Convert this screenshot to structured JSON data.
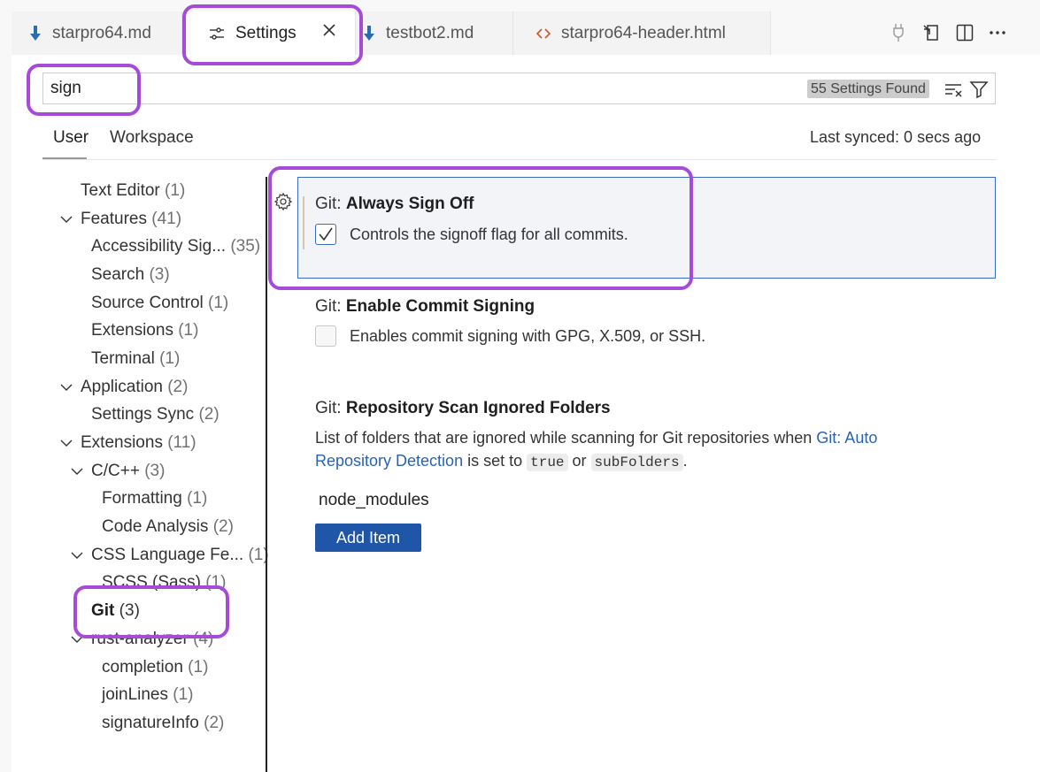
{
  "tabs": [
    {
      "label": "starpro64.md",
      "icon": "markdown-icon"
    },
    {
      "label": "Settings",
      "icon": "settings-sliders-icon",
      "active": true
    },
    {
      "label": "testbot2.md",
      "icon": "markdown-icon"
    },
    {
      "label": "starpro64-header.html",
      "icon": "html-code-icon"
    }
  ],
  "search": {
    "value": "sign",
    "found": "55 Settings Found"
  },
  "scope": {
    "user": "User",
    "workspace": "Workspace",
    "last_synced": "Last synced: 0 secs ago"
  },
  "toc": [
    {
      "label": "Text Editor",
      "count": "(1)"
    },
    {
      "label": "Features",
      "count": "(41)"
    },
    {
      "label": "Accessibility Sig...",
      "count": "(35)"
    },
    {
      "label": "Search",
      "count": "(3)"
    },
    {
      "label": "Source Control",
      "count": "(1)"
    },
    {
      "label": "Extensions",
      "count": "(1)"
    },
    {
      "label": "Terminal",
      "count": "(1)"
    },
    {
      "label": "Application",
      "count": "(2)"
    },
    {
      "label": "Settings Sync",
      "count": "(2)"
    },
    {
      "label": "Extensions",
      "count": "(11)"
    },
    {
      "label": "C/C++",
      "count": "(3)"
    },
    {
      "label": "Formatting",
      "count": "(1)"
    },
    {
      "label": "Code Analysis",
      "count": "(2)"
    },
    {
      "label": "CSS Language Fe...",
      "count": "(1)"
    },
    {
      "label": "SCSS (Sass)",
      "count": "(1)"
    },
    {
      "label": "Git",
      "count": "(3)"
    },
    {
      "label": "rust-analyzer",
      "count": "(4)"
    },
    {
      "label": "completion",
      "count": "(1)"
    },
    {
      "label": "joinLines",
      "count": "(1)"
    },
    {
      "label": "signatureInfo",
      "count": "(2)"
    }
  ],
  "settings": [
    {
      "category": "Git: ",
      "name": "Always Sign Off",
      "description": "Controls the signoff flag for all commits.",
      "checked": true
    },
    {
      "category": "Git: ",
      "name": "Enable Commit Signing",
      "description": "Enables commit signing with GPG, X.509, or SSH.",
      "checked": false
    },
    {
      "category": "Git: ",
      "name": "Repository Scan Ignored Folders",
      "desc_part1": "List of folders that are ignored while scanning for Git repositories when ",
      "link_line1": "Git: Auto",
      "link_line2": "Repository Detection",
      "desc_part2": " is set to ",
      "code1": "true",
      "desc_part3": " or ",
      "code2": "subFolders",
      "desc_part4": ".",
      "items": [
        "node_modules"
      ],
      "add_label": "Add Item"
    }
  ],
  "colors": {
    "accent": "#3a6bc2",
    "highlight": "#a64bd8",
    "button": "#1f56a8",
    "link": "#2a63b4"
  }
}
